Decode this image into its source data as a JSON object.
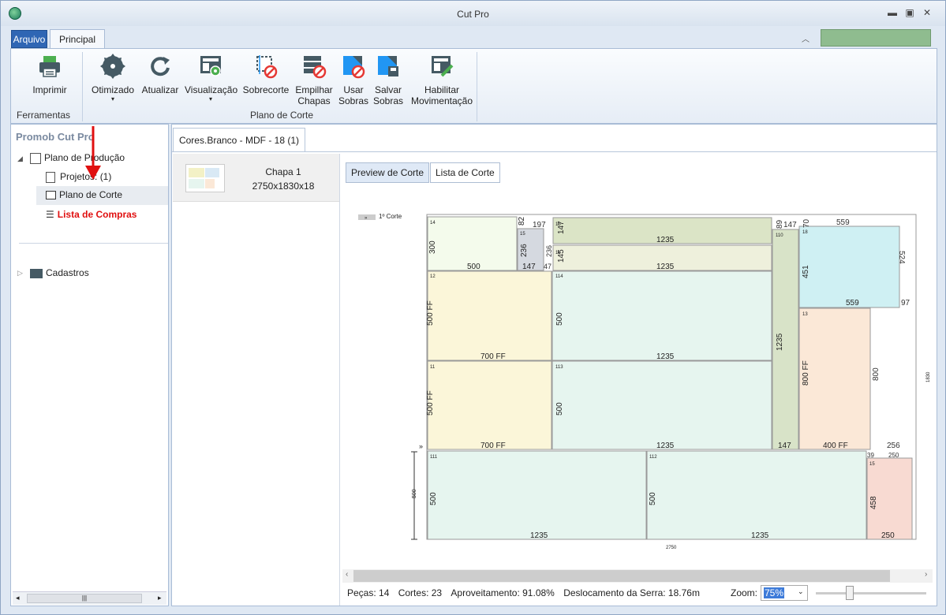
{
  "window": {
    "title": "Cut Pro"
  },
  "tabs": {
    "arquivo": "Arquivo",
    "principal": "Principal"
  },
  "ribbon": {
    "ferramentas": {
      "label": "Ferramentas",
      "imprimir": "Imprimir"
    },
    "plano": {
      "label": "Plano de Corte",
      "buttons": [
        {
          "l1": "Otimizado",
          "l2": "▾"
        },
        {
          "l1": "Atualizar",
          "l2": ""
        },
        {
          "l1": "Visualização",
          "l2": "▾"
        },
        {
          "l1": "Sobrecorte",
          "l2": ""
        },
        {
          "l1": "Empilhar",
          "l2": "Chapas"
        },
        {
          "l1": "Usar",
          "l2": "Sobras"
        },
        {
          "l1": "Salvar",
          "l2": "Sobras"
        },
        {
          "l1": "Habilitar",
          "l2": "Movimentação"
        }
      ]
    }
  },
  "left": {
    "title": "Promob Cut Pro",
    "plano_producao": "Plano de Produção",
    "projetos": "Projetos: (1)",
    "plano_corte": "Plano de Corte",
    "lista_compras": "Lista de Compras",
    "cadastros": "Cadastros"
  },
  "doc_tab": "Cores.Branco - MDF - 18 (1)",
  "sheet": {
    "name": "Chapa 1",
    "dims": "2750x1830x18"
  },
  "preview": {
    "btn_preview": "Preview de Corte",
    "btn_lista": "Lista de Corte",
    "corte_label": "1º Corte",
    "sheet_width": "2750",
    "sheet_height": "1830",
    "strip_height": "500"
  },
  "pieces": [
    {
      "id": "14",
      "w": "500",
      "h": "300",
      "color": "#f4fbec"
    },
    {
      "id": "15",
      "w": "147",
      "h": "236",
      "color": "#d5d9e0",
      "extra": "82"
    },
    {
      "id": "13",
      "w": "1235",
      "h": "147",
      "color": "#dbe4c6"
    },
    {
      "id": "11",
      "w": "1235",
      "h": "145",
      "color": "#eef0dc"
    },
    {
      "id": "12",
      "w": "700 FF",
      "h": "500 FF",
      "color": "#fbf6d9"
    },
    {
      "id": "114",
      "w": "1235",
      "h": "500",
      "color": "#e6f5ef"
    },
    {
      "id": "11",
      "w": "700 FF",
      "h": "500 FF",
      "color": "#fbf6d9"
    },
    {
      "id": "113",
      "w": "1235",
      "h": "500",
      "color": "#e6f5ef"
    },
    {
      "id": "110",
      "w": "147",
      "h": "1235",
      "color": "#d8e3c8"
    },
    {
      "id": "18",
      "w": "559",
      "h": "451",
      "color": "#cff0f3"
    },
    {
      "id": "13",
      "w": "400 FF",
      "h": "800 FF",
      "color": "#fbe8d7"
    },
    {
      "id": "111",
      "w": "1235",
      "h": "500",
      "color": "#e6f5ef"
    },
    {
      "id": "112",
      "w": "1235",
      "h": "500",
      "color": "#e6f5ef"
    },
    {
      "id": "15",
      "w": "250",
      "h": "458",
      "color": "#f8dad2"
    }
  ],
  "waste_labels": {
    "a": "197",
    "b": "47",
    "c": "147",
    "d": "89",
    "e": "70",
    "f": "559",
    "g": "524",
    "h": "97",
    "i": "800",
    "j": "256",
    "k": "250",
    "l": "39",
    "m": "236"
  },
  "status": {
    "pecas": "Peças: 14",
    "cortes": "Cortes: 23",
    "aproveitamento": "Aproveitamento: 91.08%",
    "deslocamento": "Deslocamento da Serra: 18.76m",
    "zoom_label": "Zoom:",
    "zoom_value": "75%"
  }
}
